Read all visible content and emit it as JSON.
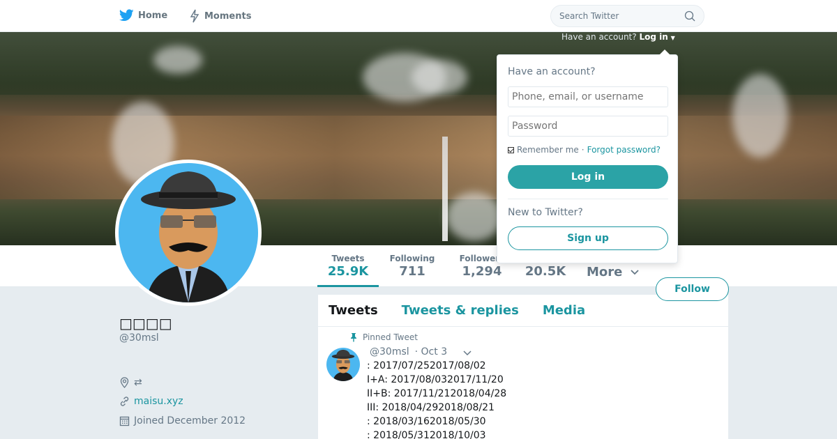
{
  "nav": {
    "home_label": "Home",
    "moments_label": "Moments",
    "search_placeholder": "Search Twitter"
  },
  "account_hint": {
    "question": "Have an account?",
    "login_label": "Log in"
  },
  "login_dropdown": {
    "title": "Have an account?",
    "username_placeholder": "Phone, email, or username",
    "password_placeholder": "Password",
    "remember_label": "Remember me",
    "separator": "·",
    "forgot_label": "Forgot password?",
    "login_button": "Log in",
    "new_prompt": "New to Twitter?",
    "signup_button": "Sign up"
  },
  "stats": [
    {
      "label": "Tweets",
      "value": "25.9K"
    },
    {
      "label": "Following",
      "value": "711"
    },
    {
      "label": "Followers",
      "value": "1,294"
    },
    {
      "label": "",
      "value": "20.5K"
    }
  ],
  "more_label": "More",
  "follow_button": "Follow",
  "profile": {
    "name": "□□□□",
    "handle": "@30msl",
    "location": "⇄",
    "website": "maisu.xyz",
    "joined": "Joined December 2012"
  },
  "tabs": [
    "Tweets",
    "Tweets & replies",
    "Media"
  ],
  "pinned_tweet": {
    "pinned_label": "Pinned Tweet",
    "handle": "@30msl",
    "date": "· Oct 3",
    "lines": [
      ": 2017/07/252017/08/02",
      "I+A: 2017/08/032017/11/20",
      "II+B: 2017/11/212018/04/28",
      "III: 2018/04/292018/08/21",
      ": 2018/03/162018/05/30",
      ": 2018/05/312018/10/03"
    ]
  },
  "colors": {
    "accent": "#1b95a0",
    "login_button": "#2ba3a6",
    "avatar_bg": "#4cb7f0",
    "page_bg": "#e6ecf0"
  }
}
